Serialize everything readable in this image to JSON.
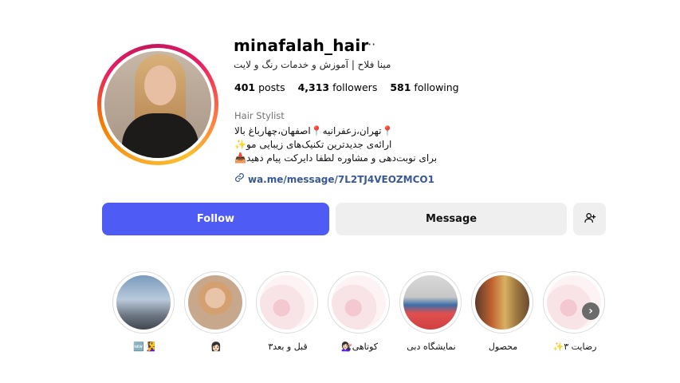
{
  "profile": {
    "username": "minafalah_hair",
    "more_glyph": "···",
    "full_name": "مینا فلاح | آموزش و خدمات رنگ و لایت",
    "stats": {
      "posts_count": "401",
      "posts_label": "posts",
      "followers_count": "4,313",
      "followers_label": "followers",
      "following_count": "581",
      "following_label": "following"
    },
    "category": "Hair Stylist",
    "bio": [
      "📍تهران،زعفرانیه📍اصفهان،چهارباغ بالا",
      "ارائه‌ی جدیدترین تکنیک‌های زیبایی مو✨",
      "برای نوبت‌دهی و مشاوره لطفا دایرکت پیام دهید📥"
    ],
    "link_icon": "link-icon",
    "link_text": "wa.me/message/7L2TJ4VEOZMCO1"
  },
  "actions": {
    "follow_label": "Follow",
    "message_label": "Message",
    "add_user_icon": "add-user-icon",
    "follow_color": "#4f5bf5"
  },
  "highlights": [
    {
      "label": "🆕🧏‍♀️"
    },
    {
      "label": "👩🏻"
    },
    {
      "label": "قبل و بعد۳"
    },
    {
      "label": "کوتاهی💇🏻‍♀️"
    },
    {
      "label": "نمایشگاه دبی"
    },
    {
      "label": "محصول"
    },
    {
      "label": "رضایت ۳✨"
    }
  ],
  "highlights_next_icon": "chevron-right-icon"
}
